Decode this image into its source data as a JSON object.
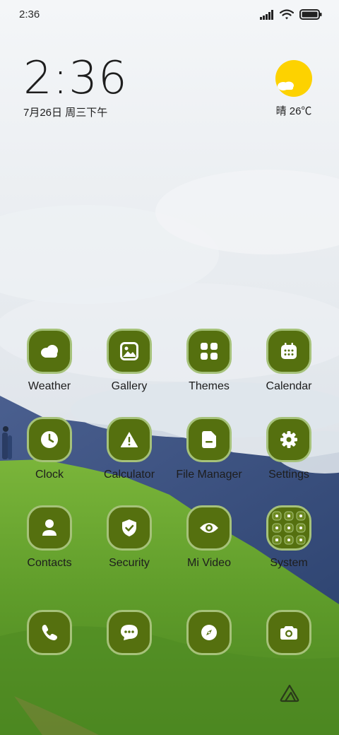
{
  "status_bar": {
    "time": "2:36"
  },
  "clock_widget": {
    "time": "2:36",
    "date": "7月26日 周三下午"
  },
  "weather_widget": {
    "summary": "晴 26℃"
  },
  "apps": [
    {
      "label": "Weather",
      "icon": "weather-icon"
    },
    {
      "label": "Gallery",
      "icon": "gallery-icon"
    },
    {
      "label": "Themes",
      "icon": "themes-icon"
    },
    {
      "label": "Calendar",
      "icon": "calendar-icon"
    },
    {
      "label": "Clock",
      "icon": "clock-icon"
    },
    {
      "label": "Calculator",
      "icon": "calculator-icon"
    },
    {
      "label": "File Manager",
      "icon": "file-manager-icon"
    },
    {
      "label": "Settings",
      "icon": "settings-icon"
    },
    {
      "label": "Contacts",
      "icon": "contacts-icon"
    },
    {
      "label": "Security",
      "icon": "security-icon"
    },
    {
      "label": "Mi Video",
      "icon": "mi-video-icon"
    },
    {
      "label": "System",
      "icon": "system-folder-icon"
    }
  ],
  "dock": [
    {
      "icon": "phone-icon"
    },
    {
      "icon": "messages-icon"
    },
    {
      "icon": "browser-icon"
    },
    {
      "icon": "camera-icon"
    }
  ],
  "colors": {
    "icon_bg": "#55700f",
    "icon_border": "#a6c27a",
    "label": "#1d1d1d"
  }
}
